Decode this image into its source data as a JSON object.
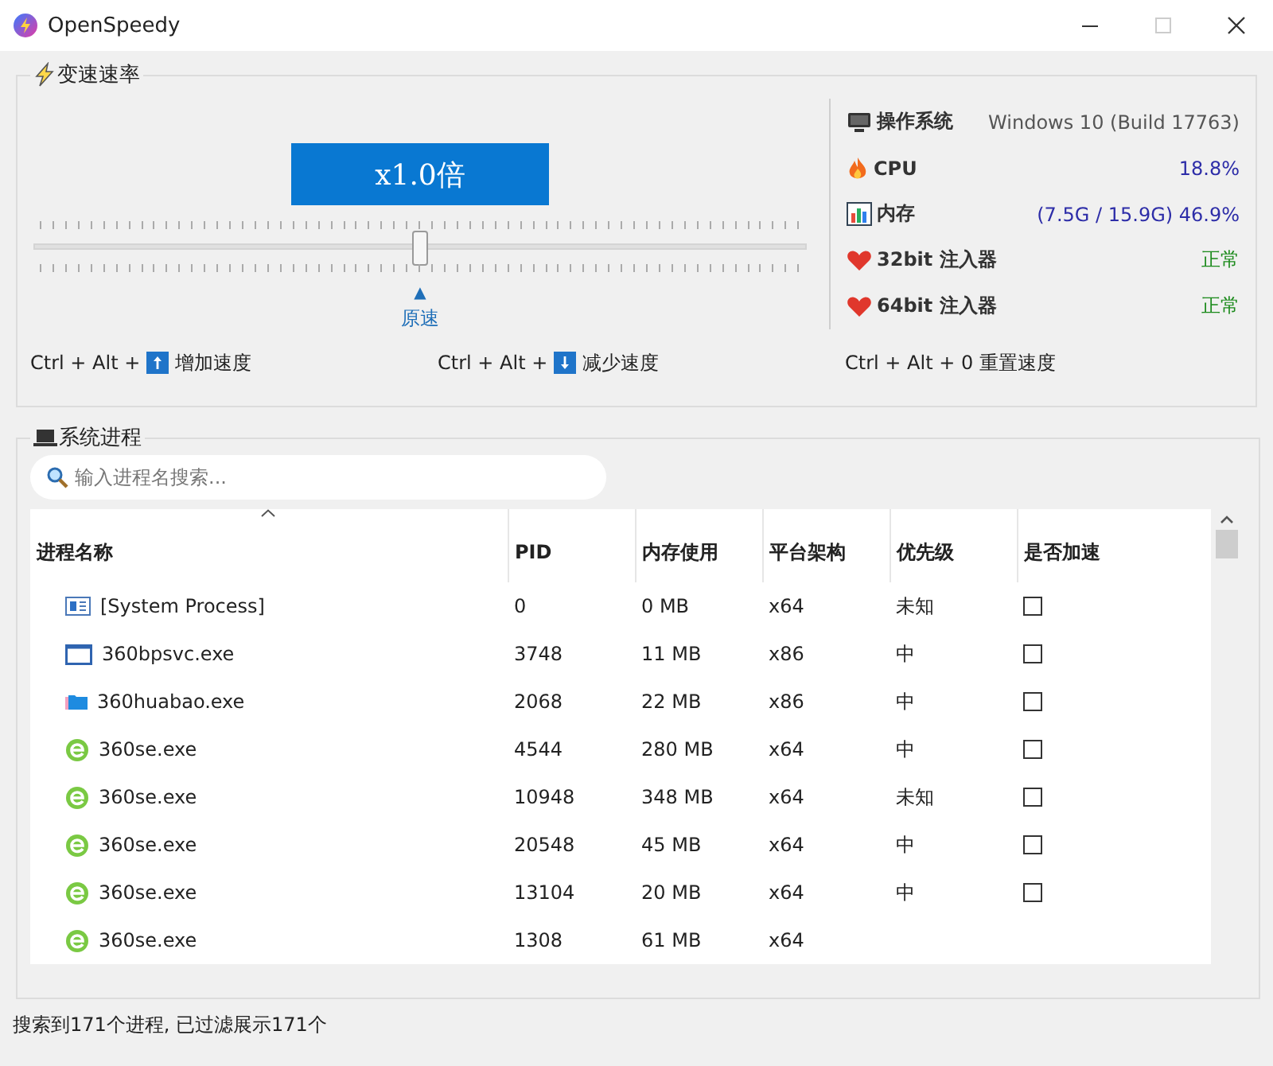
{
  "window": {
    "title": "OpenSpeedy"
  },
  "speed_group": {
    "title": "变速速率",
    "display": "x1.0倍",
    "slider": {
      "level": 0.5
    },
    "marker": "▲",
    "marker_label": "原速",
    "info": [
      {
        "kind": "os",
        "label": "操作系统",
        "value": "Windows 10 (Build 17763)"
      },
      {
        "kind": "cpu",
        "label": "CPU",
        "value": "18.8%"
      },
      {
        "kind": "memory",
        "label": "内存",
        "value": "(7.5G / 15.9G) 46.9%"
      },
      {
        "kind": "injector",
        "label": "32bit 注入器",
        "value": "正常"
      },
      {
        "kind": "injector",
        "label": "64bit 注入器",
        "value": "正常"
      }
    ],
    "shortcuts": [
      {
        "kind": "up",
        "keys": "Ctrl + Alt +",
        "action": "增加速度"
      },
      {
        "kind": "down",
        "keys": "Ctrl + Alt +",
        "action": "减少速度"
      },
      {
        "kind": "text",
        "keys": "Ctrl + Alt + 0",
        "action": "重置速度"
      }
    ]
  },
  "process_group": {
    "title": "系统进程",
    "search": {
      "placeholder": "输入进程名搜索..."
    },
    "table": {
      "columns": [
        "进程名称",
        "PID",
        "内存使用",
        "平台架构",
        "优先级",
        "是否加速"
      ],
      "rows": [
        {
          "kind": "system",
          "name": "[System Process]",
          "pid": "0",
          "memory": "0 MB",
          "arch": "x64",
          "priority": "未知",
          "checked": false
        },
        {
          "kind": "window",
          "name": "360bpsvc.exe",
          "pid": "3748",
          "memory": "11 MB",
          "arch": "x86",
          "priority": "中",
          "checked": false
        },
        {
          "kind": "folder",
          "name": "360huabao.exe",
          "pid": "2068",
          "memory": "22 MB",
          "arch": "x86",
          "priority": "中",
          "checked": false
        },
        {
          "kind": "browser",
          "name": "360se.exe",
          "pid": "4544",
          "memory": "280 MB",
          "arch": "x64",
          "priority": "中",
          "checked": false
        },
        {
          "kind": "browser",
          "name": "360se.exe",
          "pid": "10948",
          "memory": "348 MB",
          "arch": "x64",
          "priority": "未知",
          "checked": false
        },
        {
          "kind": "browser",
          "name": "360se.exe",
          "pid": "20548",
          "memory": "45 MB",
          "arch": "x64",
          "priority": "中",
          "checked": false
        },
        {
          "kind": "browser",
          "name": "360se.exe",
          "pid": "13104",
          "memory": "20 MB",
          "arch": "x64",
          "priority": "中",
          "checked": false
        },
        {
          "kind": "browser",
          "name": "360se.exe",
          "pid": "1308",
          "memory": "61 MB",
          "arch": "x64"
        }
      ]
    }
  },
  "status_bar": "搜索到171个进程, 已过滤展示171个"
}
